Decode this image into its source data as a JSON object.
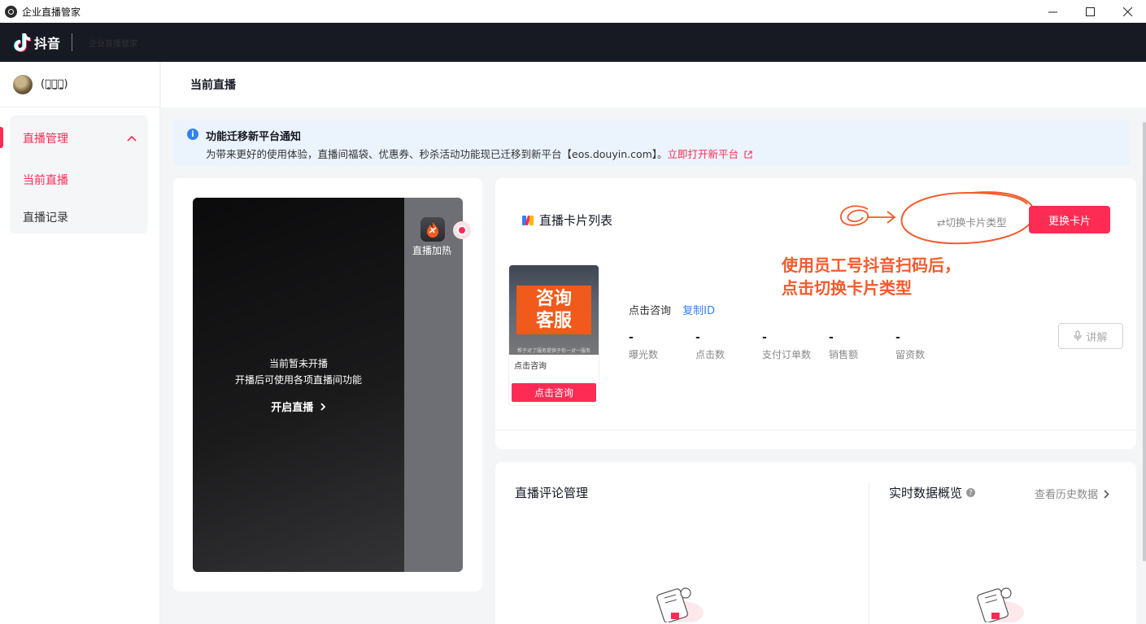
{
  "window": {
    "title": "企业直播管家",
    "controls": [
      "minimize",
      "maximize",
      "close"
    ]
  },
  "topbar": {
    "brand": "抖音",
    "product": "企业直播管家"
  },
  "sidebar": {
    "username": "(ꪔ̤̥ꪔ̤̮ꪔ̤̥)",
    "menu_group": "直播管理",
    "items": [
      {
        "label": "当前直播",
        "active": true
      },
      {
        "label": "直播记录",
        "active": false
      }
    ]
  },
  "page": {
    "title": "当前直播"
  },
  "notice": {
    "title": "功能迁移新平台通知",
    "body": "为带来更好的使用体验，直播间福袋、优惠券、秒杀活动功能现已迁移到新平台【eos.douyin.com】。",
    "link": "立即打开新平台"
  },
  "preview": {
    "line1": "当前暂未开播",
    "line2": "开播后可使用各项直播间功能",
    "start_label": "开启直播",
    "heat_label": "直播加热"
  },
  "card_list": {
    "title": "直播卡片列表",
    "switch_type_label": "⇄切换卡片类型",
    "change_card_label": "更换卡片",
    "annotation_line1": "使用员工号抖音扫码后，",
    "annotation_line2": "点击切换卡片类型",
    "product": {
      "tag_line1": "咨询",
      "tag_line2": "客服",
      "strip_text": "帮子对了服务提供于你一对一服务",
      "name": "点击咨询",
      "button": "点击咨询"
    },
    "info": {
      "card_name": "点击咨询",
      "copy_id": "复制ID"
    },
    "stats": [
      {
        "value": "-",
        "label": "曝光数"
      },
      {
        "value": "-",
        "label": "点击数"
      },
      {
        "value": "-",
        "label": "支付订单数"
      },
      {
        "value": "-",
        "label": "销售额"
      },
      {
        "value": "-",
        "label": "留资数"
      }
    ],
    "explain_label": "讲解"
  },
  "comments": {
    "title": "直播评论管理"
  },
  "realtime": {
    "title": "实时数据概览",
    "history_link": "查看历史数据"
  },
  "colors": {
    "accent": "#fe2c55",
    "annotation": "#f55a2c",
    "topbar": "#171923",
    "link": "#3381f7"
  }
}
